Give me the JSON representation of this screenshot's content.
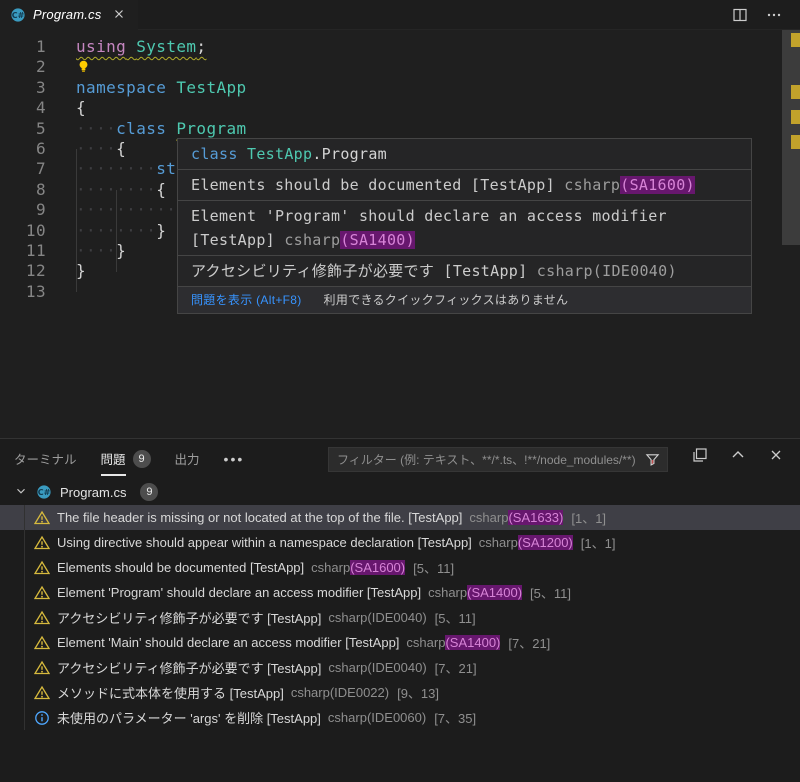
{
  "tab": {
    "title": "Program.cs"
  },
  "code": {
    "lines": [
      {
        "n": "1",
        "squiggle_full": true,
        "tokens": [
          {
            "text": "using",
            "type": "kw2"
          },
          {
            "text": " ",
            "type": "plain"
          },
          {
            "text": "System",
            "type": "type"
          },
          {
            "text": ";",
            "type": "plain"
          }
        ]
      },
      {
        "n": "2",
        "lightbulb": true,
        "tokens": []
      },
      {
        "n": "3",
        "tokens": [
          {
            "text": "namespace",
            "type": "kw"
          },
          {
            "text": " ",
            "type": "plain"
          },
          {
            "text": "TestApp",
            "type": "type"
          }
        ]
      },
      {
        "n": "4",
        "tokens": [
          {
            "text": "{",
            "type": "plain"
          }
        ]
      },
      {
        "n": "5",
        "tokens": [
          {
            "text": "····",
            "type": "ws"
          },
          {
            "text": "class",
            "type": "kw"
          },
          {
            "text": " ",
            "type": "plain"
          },
          {
            "text": "Program",
            "type": "type",
            "squiggle": true
          }
        ]
      },
      {
        "n": "6",
        "tokens": [
          {
            "text": "····",
            "type": "ws"
          },
          {
            "text": "{",
            "type": "plain"
          }
        ]
      },
      {
        "n": "7",
        "tokens": [
          {
            "text": "········",
            "type": "ws"
          },
          {
            "text": "st",
            "type": "kw"
          }
        ]
      },
      {
        "n": "8",
        "tokens": [
          {
            "text": "········",
            "type": "ws"
          },
          {
            "text": "{",
            "type": "plain"
          }
        ]
      },
      {
        "n": "9",
        "tokens": [
          {
            "text": "············",
            "type": "ws"
          }
        ]
      },
      {
        "n": "10",
        "tokens": [
          {
            "text": "········",
            "type": "ws"
          },
          {
            "text": "}",
            "type": "plain"
          }
        ]
      },
      {
        "n": "11",
        "tokens": [
          {
            "text": "····",
            "type": "ws"
          },
          {
            "text": "}",
            "type": "plain"
          }
        ]
      },
      {
        "n": "12",
        "tokens": [
          {
            "text": "}",
            "type": "plain"
          }
        ]
      },
      {
        "n": "13",
        "tokens": []
      }
    ]
  },
  "hover": {
    "signature": [
      {
        "text": "class",
        "type": "kw"
      },
      {
        "text": " ",
        "type": "plain"
      },
      {
        "text": "TestApp",
        "type": "type"
      },
      {
        "text": ".Program",
        "type": "plain"
      }
    ],
    "diagnostics": [
      {
        "message": "Elements should be documented [TestApp] ",
        "source": "csharp",
        "code": "(SA1600)",
        "highlight": true
      },
      {
        "message": "Element 'Program' should declare an access modifier [TestApp] ",
        "source": "csharp",
        "code": "(SA1400)",
        "highlight": true
      },
      {
        "message": "アクセシビリティ修飾子が必要です [TestApp] ",
        "source": "csharp",
        "code": "(IDE0040)",
        "highlight": false
      }
    ],
    "status": {
      "link": "問題を表示 (Alt+F8)",
      "hint": "利用できるクイックフィックスはありません"
    }
  },
  "panel": {
    "tabs": [
      {
        "label": "ターミナル",
        "active": false
      },
      {
        "label": "問題",
        "active": true,
        "badge": "9"
      },
      {
        "label": "出力",
        "active": false
      }
    ],
    "more_label": "•••",
    "filter_placeholder": "フィルター (例: テキスト、**/*.ts、!**/node_modules/**)",
    "group": {
      "file": "Program.cs",
      "badge": "9"
    },
    "problems": [
      {
        "sev": "warning",
        "selected": true,
        "message": "The file header is missing or not located at the top of the file. [TestApp]",
        "source": "csharp",
        "code": "(SA1633)",
        "highlight": true,
        "pos": "[1、1]"
      },
      {
        "sev": "warning",
        "message": "Using directive should appear within a namespace declaration [TestApp]",
        "source": "csharp",
        "code": "(SA1200)",
        "highlight": true,
        "pos": "[1、1]"
      },
      {
        "sev": "warning",
        "message": "Elements should be documented [TestApp]",
        "source": "csharp",
        "code": "(SA1600)",
        "highlight": true,
        "pos": "[5、11]"
      },
      {
        "sev": "warning",
        "message": "Element 'Program' should declare an access modifier [TestApp]",
        "source": "csharp",
        "code": "(SA1400)",
        "highlight": true,
        "pos": "[5、11]"
      },
      {
        "sev": "warning",
        "message": "アクセシビリティ修飾子が必要です [TestApp]",
        "source": "csharp",
        "code": "(IDE0040)",
        "highlight": false,
        "pos": "[5、11]"
      },
      {
        "sev": "warning",
        "message": "Element 'Main' should declare an access modifier [TestApp]",
        "source": "csharp",
        "code": "(SA1400)",
        "highlight": true,
        "pos": "[7、21]"
      },
      {
        "sev": "warning",
        "message": "アクセシビリティ修飾子が必要です [TestApp]",
        "source": "csharp",
        "code": "(IDE0040)",
        "highlight": false,
        "pos": "[7、21]"
      },
      {
        "sev": "warning",
        "message": "メソッドに式本体を使用する [TestApp]",
        "source": "csharp",
        "code": "(IDE0022)",
        "highlight": false,
        "pos": "[9、13]"
      },
      {
        "sev": "info",
        "message": "未使用のパラメーター 'args' を削除 [TestApp]",
        "source": "csharp",
        "code": "(IDE0060)",
        "highlight": false,
        "pos": "[7、35]"
      }
    ]
  },
  "colors": {
    "accent_link": "#3794ff",
    "warning": "#d7ba3d",
    "info": "#4fa8ff",
    "highlight_bg": "#67176e",
    "highlight_fg": "#d783d7",
    "keyword": "#569cd6",
    "keyword_control": "#c586c0",
    "type_name": "#4ec9b0"
  }
}
